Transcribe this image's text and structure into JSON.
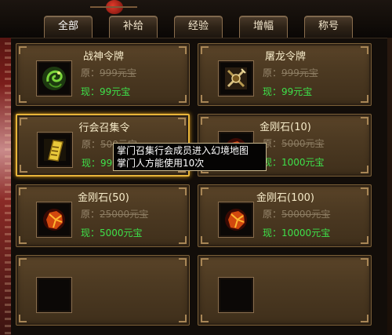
{
  "tabs": [
    {
      "label": "全部",
      "active": true
    },
    {
      "label": "补给",
      "active": false
    },
    {
      "label": "经验",
      "active": false
    },
    {
      "label": "增幅",
      "active": false
    },
    {
      "label": "称号",
      "active": false
    }
  ],
  "colors": {
    "name": "#f6ebc9",
    "price_now": "#3ee04a",
    "price_orig": "#9a8a70",
    "selected_border": "#e8b53a"
  },
  "items": [
    {
      "name": "战神令牌",
      "orig_prefix": "原：",
      "orig_price": "999元宝",
      "now_prefix": "现：",
      "now_price": "99元宝",
      "icon": "dragon-token-icon"
    },
    {
      "name": "屠龙令牌",
      "orig_prefix": "原：",
      "orig_price": "999元宝",
      "now_prefix": "现：",
      "now_price": "99元宝",
      "icon": "crossed-blades-token-icon"
    },
    {
      "name": "行会召集令",
      "orig_prefix": "原：",
      "orig_price": "500元宝",
      "now_prefix": "现：",
      "now_price": "99元宝",
      "icon": "summon-scroll-icon",
      "selected": true
    },
    {
      "name": "金刚石(10)",
      "orig_prefix": "原：",
      "orig_price": "5000元宝",
      "now_prefix": "现：",
      "now_price": "1000元宝",
      "icon": "diamond-ore-icon"
    },
    {
      "name": "金刚石(50)",
      "orig_prefix": "原：",
      "orig_price": "25000元宝",
      "now_prefix": "现：",
      "now_price": "5000元宝",
      "icon": "diamond-ore-icon"
    },
    {
      "name": "金刚石(100)",
      "orig_prefix": "原：",
      "orig_price": "50000元宝",
      "now_prefix": "现：",
      "now_price": "10000元宝",
      "icon": "diamond-ore-icon"
    }
  ],
  "tooltip": {
    "line1": "掌门召集行会成员进入幻境地图",
    "line2": "掌门人方能使用10次"
  }
}
